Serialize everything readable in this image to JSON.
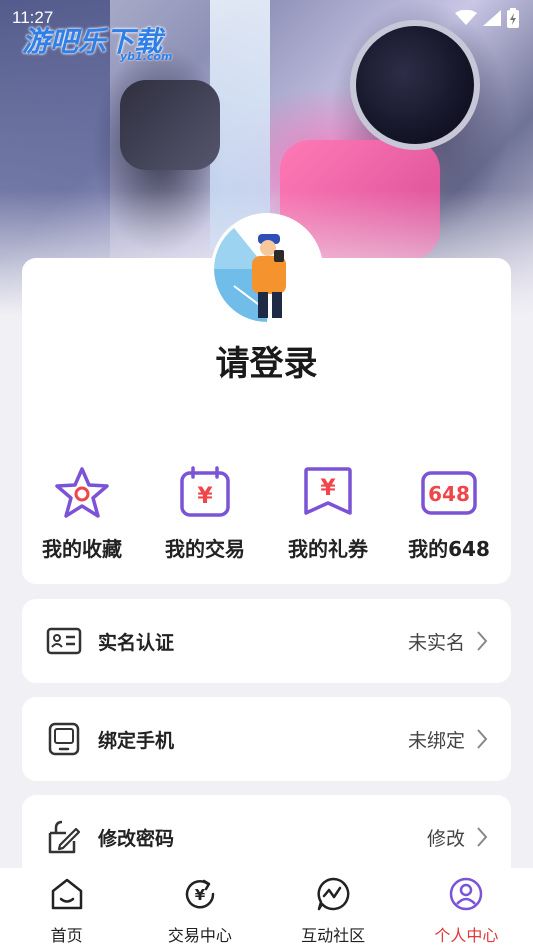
{
  "status_bar": {
    "time": "11:27"
  },
  "watermark": {
    "main": "游吧乐下载",
    "sub": "yb1.com"
  },
  "profile": {
    "login_prompt": "请登录"
  },
  "quick_actions": [
    {
      "label": "我的收藏",
      "icon": "star-icon"
    },
    {
      "label": "我的交易",
      "icon": "calendar-yen-icon"
    },
    {
      "label": "我的礼券",
      "icon": "voucher-yen-icon"
    },
    {
      "label": "我的648",
      "icon": "badge-648-icon",
      "badge_text": "648"
    }
  ],
  "menu": [
    {
      "label": "实名认证",
      "value": "未实名",
      "icon": "id-card-icon"
    },
    {
      "label": "绑定手机",
      "value": "未绑定",
      "icon": "phone-icon"
    },
    {
      "label": "修改密码",
      "value": "修改",
      "icon": "edit-lock-icon"
    }
  ],
  "tabs": [
    {
      "label": "首页",
      "icon": "home-icon",
      "active": false
    },
    {
      "label": "交易中心",
      "icon": "exchange-yen-icon",
      "active": false
    },
    {
      "label": "互动社区",
      "icon": "chat-pulse-icon",
      "active": false
    },
    {
      "label": "个人中心",
      "icon": "user-icon",
      "active": true
    }
  ],
  "colors": {
    "accent_purple": "#7b53d6",
    "accent_red": "#e0393e",
    "badge_red": "#f0464b"
  }
}
